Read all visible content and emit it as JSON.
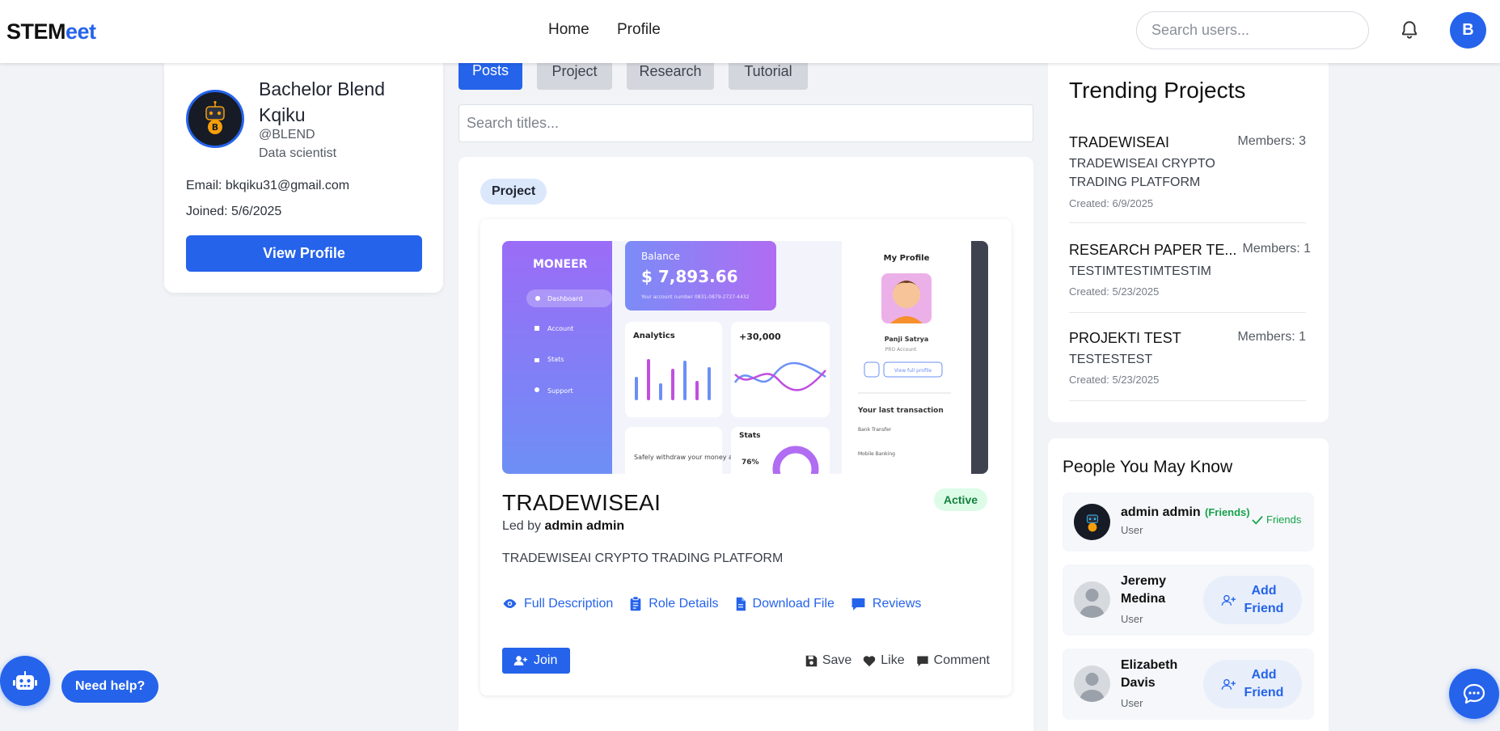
{
  "header": {
    "logo_main": "STEM",
    "logo_accent": "eet",
    "nav": [
      {
        "label": "Home"
      },
      {
        "label": "Profile"
      }
    ],
    "search_placeholder": "Search users...",
    "avatar_initial": "B",
    "icons": {
      "bell": "bell-icon"
    }
  },
  "profile": {
    "name": "Bachelor Blend Kqiku",
    "handle": "@BLEND",
    "role": "Data scientist",
    "email": "Email: bkqiku31@gmail.com",
    "joined": "Joined: 5/6/2025",
    "view_profile_label": "View Profile"
  },
  "feed": {
    "tabs": [
      {
        "label": "Posts",
        "active": true
      },
      {
        "label": "Project",
        "active": false
      },
      {
        "label": "Research",
        "active": false
      },
      {
        "label": "Tutorial",
        "active": false
      }
    ],
    "search_placeholder": "Search titles...",
    "post": {
      "type_badge": "Project",
      "image": {
        "brand": "MONEER",
        "menu": [
          "Dashboard",
          "Account",
          "Stats",
          "Support"
        ],
        "balance_label": "Balance",
        "balance_value": "$ 7,893.66",
        "account_number": "Your account number 0831-0879-2727-4432",
        "analytics_label": "Analytics",
        "gain_value": "+30,000",
        "stats_label": "Stats",
        "stats_percent": "76%",
        "withdraw_text": "Safely withdraw your money anywhere",
        "my_profile_label": "My Profile",
        "profile_name": "Panji Satrya",
        "profile_sub": "PRO Account",
        "view_full_profile": "View full profile",
        "last_transaction_label": "Your last transaction",
        "transactions": [
          "Bank Transfer",
          "Mobile Banking"
        ]
      },
      "title": "TRADEWISEAI",
      "status": "Active",
      "led_by_prefix": "Led by",
      "led_by_name": "admin admin",
      "description": "TRADEWISEAI CRYPTO TRADING PLATFORM",
      "actions": [
        {
          "label": "Full Description",
          "icon": "eye-icon"
        },
        {
          "label": "Role Details",
          "icon": "clipboard-icon"
        },
        {
          "label": "Download File",
          "icon": "file-icon"
        },
        {
          "label": "Reviews",
          "icon": "comment-icon"
        }
      ],
      "join_label": "Join",
      "save_label": "Save",
      "like_label": "Like",
      "comment_label": "Comment"
    }
  },
  "trending": {
    "title": "Trending Projects",
    "items": [
      {
        "name": "TRADEWISEAI",
        "members": "Members: 3",
        "description": "TRADEWISEAI CRYPTO TRADING PLATFORM",
        "created": "Created: 6/9/2025"
      },
      {
        "name": "RESEARCH PAPER TE...",
        "members": "Members: 1",
        "description": "TESTIMTESTIMTESTIM",
        "created": "Created: 5/23/2025"
      },
      {
        "name": "PROJEKTI TEST",
        "members": "Members: 1",
        "description": "TESTESTEST",
        "created": "Created: 5/23/2025"
      }
    ]
  },
  "people": {
    "title": "People You May Know",
    "items": [
      {
        "name": "admin admin",
        "role": "User",
        "tag": "(Friends)",
        "status": "Friends"
      },
      {
        "name": "Jeremy Medina",
        "role": "User",
        "button": "Add Friend"
      },
      {
        "name": "Elizabeth Davis",
        "role": "User",
        "button": "Add Friend"
      }
    ]
  },
  "floating": {
    "help_label": "Need help?",
    "bot_icon": "robot-icon",
    "chat_icon": "chat-bubble-icon"
  },
  "colors": {
    "primary": "#2563eb",
    "page_bg": "#f1f3f6",
    "success": "#16a34a",
    "tab_inactive": "#d3d6dc"
  }
}
